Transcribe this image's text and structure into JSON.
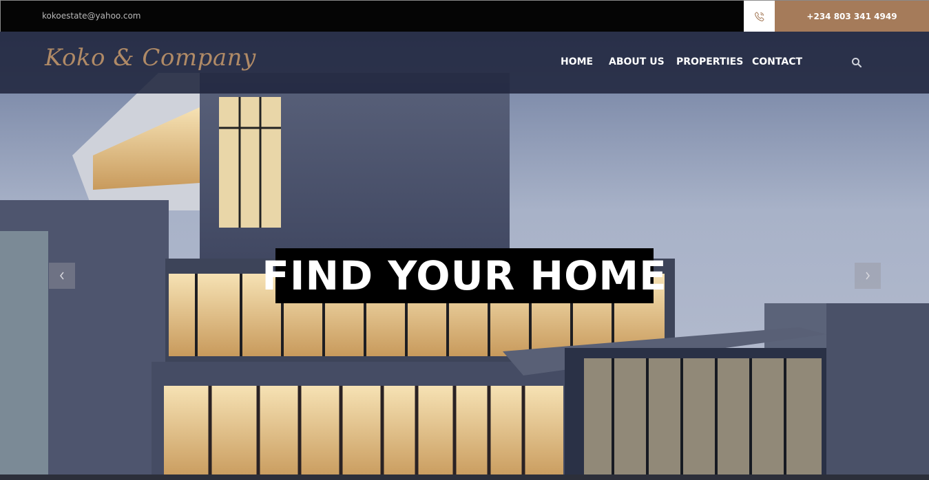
{
  "topbar": {
    "email": "kokoestate@yahoo.com",
    "phone": "+234 803 341 4949",
    "phone_icon": "phone-icon"
  },
  "nav": {
    "brand": "Koko & Company",
    "items": [
      {
        "label": "HOME"
      },
      {
        "label": "ABOUT US"
      },
      {
        "label": "PROPERTIES"
      },
      {
        "label": "CONTACT"
      }
    ],
    "search_icon": "search-icon"
  },
  "hero": {
    "headline": "FIND YOUR HOME",
    "prev_icon": "chevron-left-icon",
    "next_icon": "chevron-right-icon"
  },
  "colors": {
    "accent": "#a57b5a",
    "brand": "#b08a66",
    "topbar": "#050505",
    "navbar": "#20263e"
  }
}
